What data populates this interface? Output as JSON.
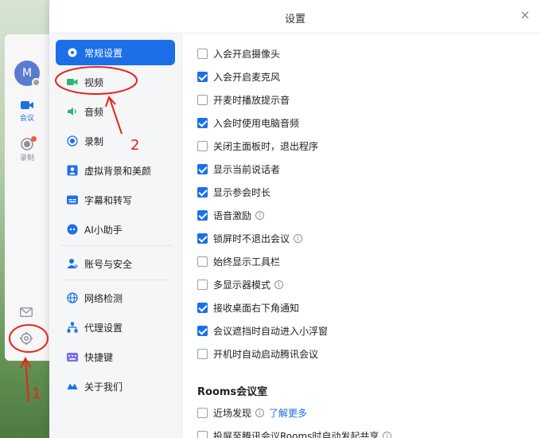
{
  "app_rail": {
    "avatar_letter": "M",
    "meeting_label": "会议",
    "record_label": "录制"
  },
  "dialog": {
    "title": "设置",
    "close_glyph": "×"
  },
  "nav": {
    "items": [
      {
        "label": "常规设置",
        "icon": "gear-icon",
        "active": true
      },
      {
        "label": "视频",
        "icon": "video-camera-icon",
        "active": false
      },
      {
        "label": "音频",
        "icon": "speaker-icon",
        "active": false
      },
      {
        "label": "录制",
        "icon": "record-icon",
        "active": false
      },
      {
        "label": "虚拟背景和美颜",
        "icon": "portrait-icon",
        "active": false
      },
      {
        "label": "字幕和转写",
        "icon": "subtitles-icon",
        "active": false
      },
      {
        "label": "AI小助手",
        "icon": "ai-assistant-icon",
        "active": false
      },
      {
        "label": "账号与安全",
        "icon": "account-icon",
        "active": false
      },
      {
        "label": "网络检测",
        "icon": "globe-icon",
        "active": false
      },
      {
        "label": "代理设置",
        "icon": "proxy-icon",
        "active": false
      },
      {
        "label": "快捷键",
        "icon": "keyboard-icon",
        "active": false
      },
      {
        "label": "关于我们",
        "icon": "about-icon",
        "active": false
      }
    ]
  },
  "options": [
    {
      "label": "入会开启摄像头",
      "checked": false,
      "info": false
    },
    {
      "label": "入会开启麦克风",
      "checked": true,
      "info": false
    },
    {
      "label": "开麦时播放提示音",
      "checked": false,
      "info": false
    },
    {
      "label": "入会时使用电脑音频",
      "checked": true,
      "info": false
    },
    {
      "label": "关闭主面板时，退出程序",
      "checked": false,
      "info": false
    },
    {
      "label": "显示当前说话者",
      "checked": true,
      "info": false
    },
    {
      "label": "显示参会时长",
      "checked": true,
      "info": false
    },
    {
      "label": "语音激励",
      "checked": true,
      "info": true
    },
    {
      "label": "锁屏时不退出会议",
      "checked": true,
      "info": true
    },
    {
      "label": "始终显示工具栏",
      "checked": false,
      "info": false
    },
    {
      "label": "多显示器模式",
      "checked": false,
      "info": true
    },
    {
      "label": "接收桌面右下角通知",
      "checked": true,
      "info": false
    },
    {
      "label": "会议遮挡时自动进入小浮窗",
      "checked": true,
      "info": false
    },
    {
      "label": "开机时自动启动腾讯会议",
      "checked": false,
      "info": false
    }
  ],
  "rooms": {
    "title": "Rooms会议室",
    "nearby_label": "近场发现",
    "learn_more": "了解更多",
    "next_label": "投屏至腾讯会议Rooms时自动发起共享"
  },
  "annotations": {
    "label_1": "1",
    "label_2": "2"
  },
  "colors": {
    "accent": "#1d6fe8",
    "annotation_red": "#e8231f"
  }
}
